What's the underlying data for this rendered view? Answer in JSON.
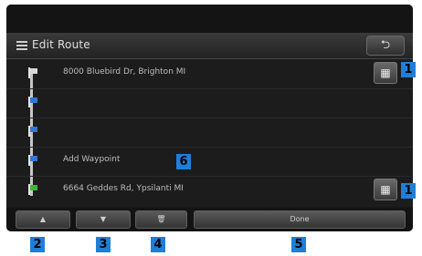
{
  "header": {
    "title": "Edit Route",
    "back_glyph": "⮌"
  },
  "rows": [
    {
      "text": "8000 Bluebird Dr, Brighton MI",
      "flag_color": "#d8d8d8"
    },
    {
      "text": "",
      "flag_color": "#2b78d6"
    },
    {
      "text": "",
      "flag_color": "#2b78d6"
    },
    {
      "text": "Add Waypoint",
      "flag_color": "#2b78d6"
    },
    {
      "text": "6664 Geddes Rd, Ypsilanti MI",
      "flag_color": "#38b838"
    }
  ],
  "map_glyph": "▦",
  "footer": {
    "up_glyph": "▲",
    "down_glyph": "▼",
    "delete_glyph": "🗑",
    "done_label": "Done"
  },
  "callouts": {
    "map_top": "1",
    "map_bottom": "1",
    "up": "2",
    "down": "3",
    "delete": "4",
    "done": "5",
    "add_waypoint": "6"
  },
  "colors": {
    "callout": "#1f7fd8",
    "dest_flag": "#38b838",
    "waypoint_flag": "#2b78d6"
  }
}
